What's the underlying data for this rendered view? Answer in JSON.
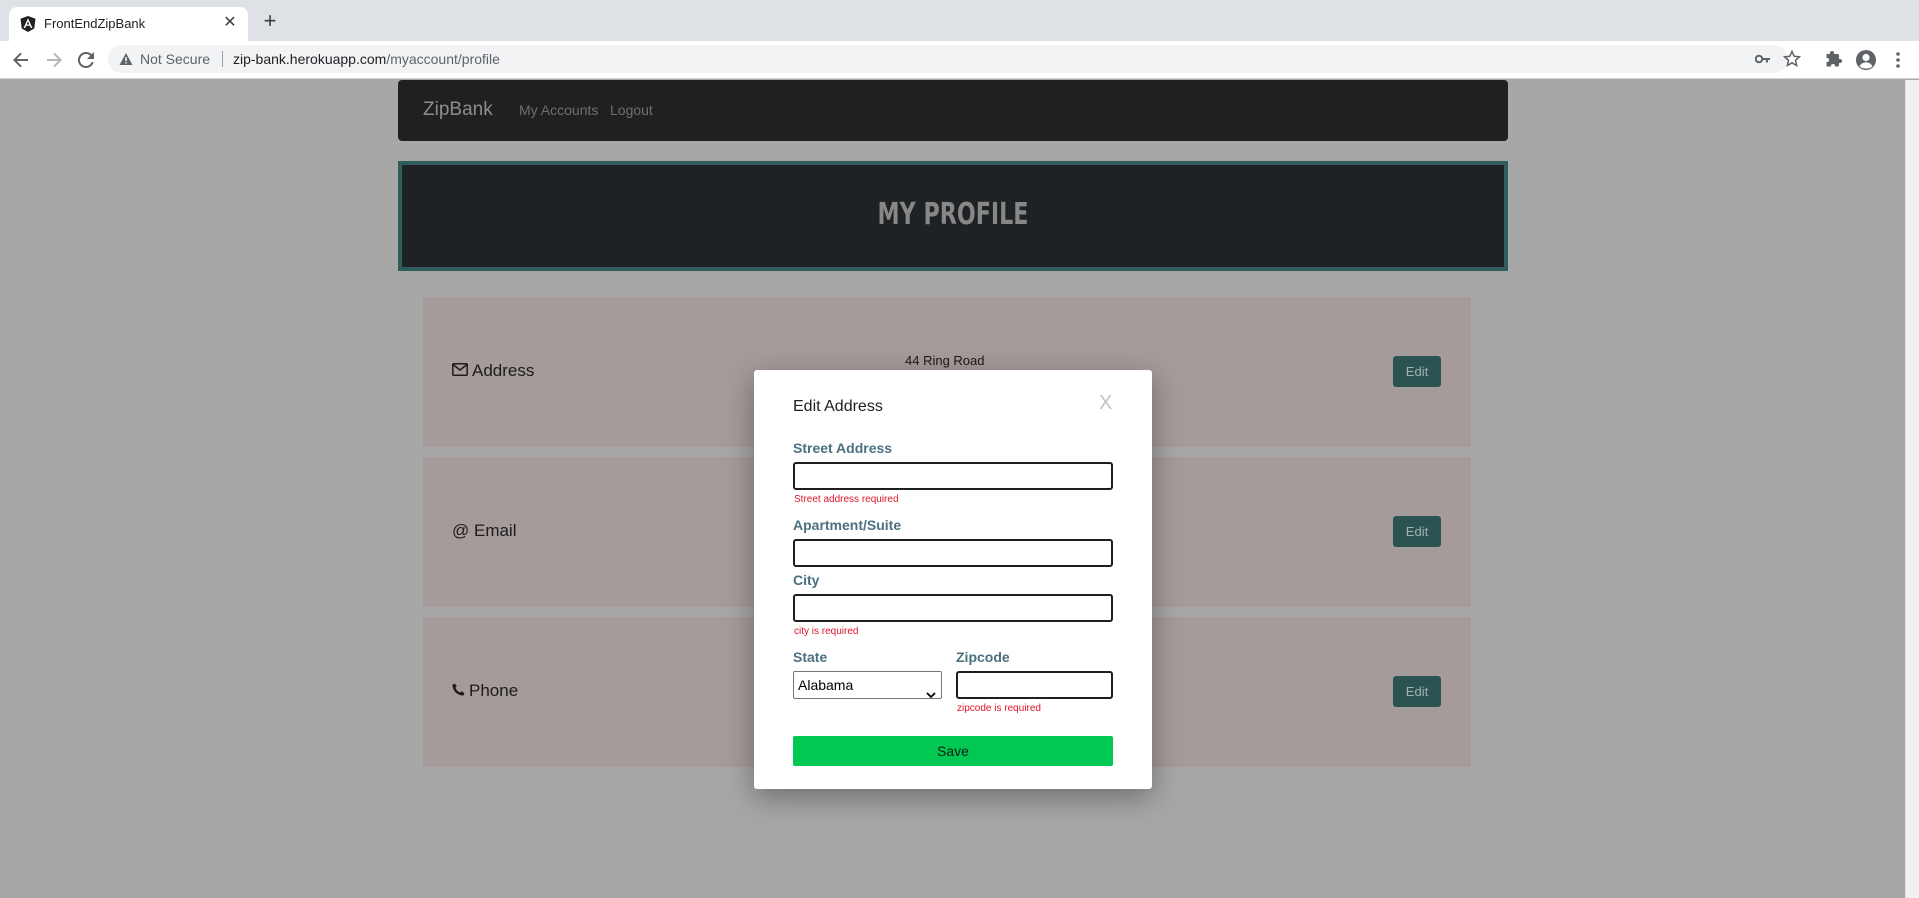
{
  "browser": {
    "tab_title": "FrontEndZipBank",
    "security_label": "Not Secure",
    "url_host": "zip-bank.herokuapp.com",
    "url_path": "/myaccount/profile"
  },
  "navbar": {
    "brand": "ZipBank",
    "links": [
      "My Accounts",
      "Logout"
    ]
  },
  "header": {
    "title": "MY PROFILE"
  },
  "cards": [
    {
      "label": "Address",
      "icon": "envelope-icon",
      "value": "44 Ring Road",
      "edit_label": "Edit"
    },
    {
      "label": "@ Email",
      "icon": "",
      "value": "",
      "edit_label": "Edit"
    },
    {
      "label": "Phone",
      "icon": "phone-icon",
      "value": "",
      "edit_label": "Edit"
    }
  ],
  "modal": {
    "title": "Edit Address",
    "close_label": "X",
    "fields": {
      "street": {
        "label": "Street Address",
        "value": "",
        "error": "Street address required"
      },
      "apartment": {
        "label": "Apartment/Suite",
        "value": ""
      },
      "city": {
        "label": "City",
        "value": "",
        "error": "city is required"
      },
      "state": {
        "label": "State",
        "selected": "Alabama"
      },
      "zipcode": {
        "label": "Zipcode",
        "value": "",
        "error": "zipcode is required"
      }
    },
    "save_label": "Save"
  },
  "colors": {
    "save_button": "#00c853",
    "edit_button": "#2a5352",
    "error_text": "#e0142b",
    "header_border": "#305e5d"
  }
}
